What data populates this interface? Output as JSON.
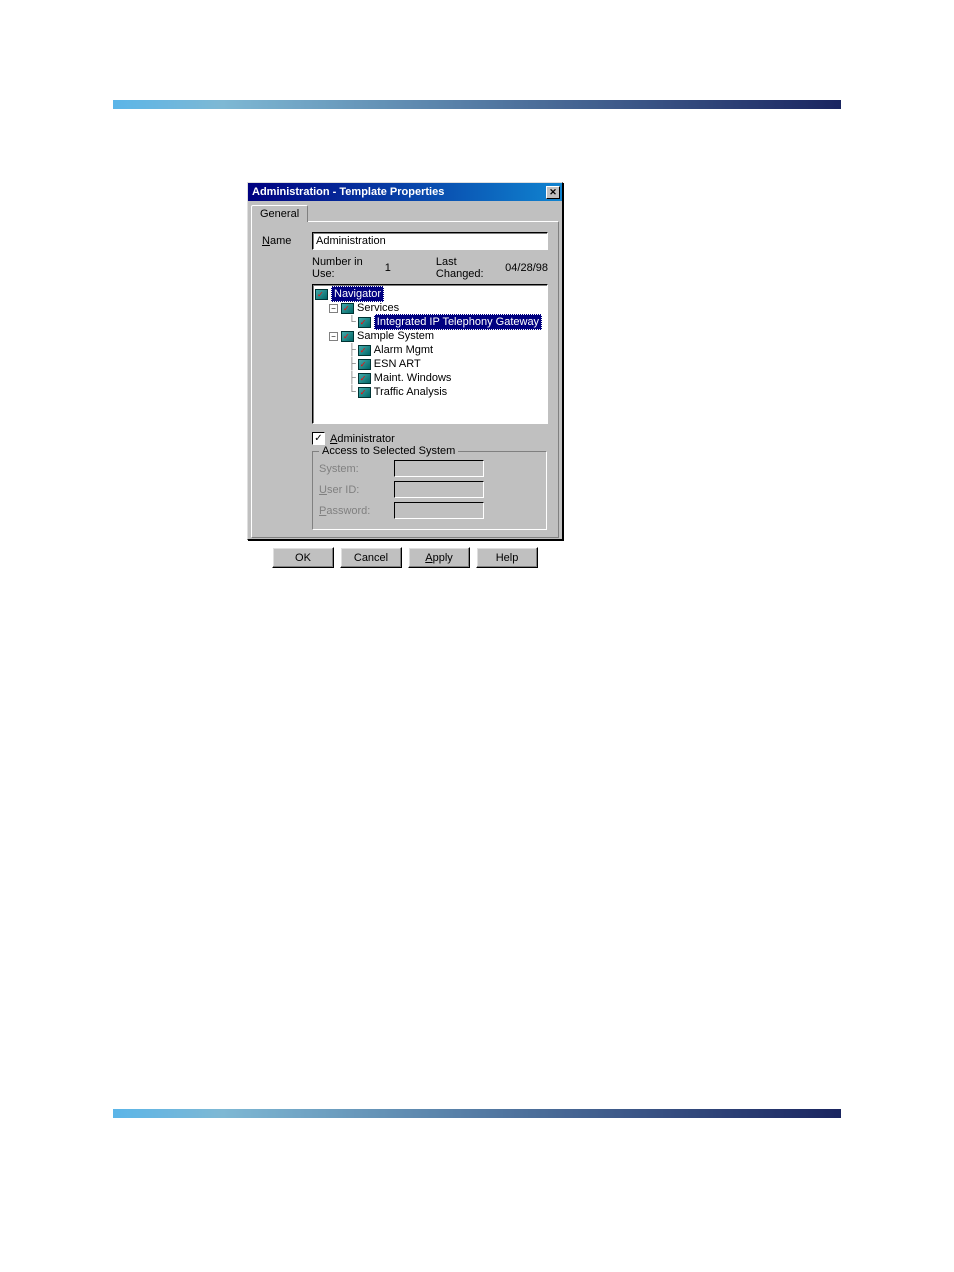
{
  "dialog": {
    "title": "Administration - Template Properties",
    "tab": "General",
    "name_label": "Name",
    "name_underline": "N",
    "name_value": "Administration",
    "number_in_use_label": "Number in Use:",
    "number_in_use_value": "1",
    "last_changed_label": "Last Changed:",
    "last_changed_value": "04/28/98",
    "tree": {
      "root": "Navigator",
      "services": "Services",
      "itg": "Integrated IP Telephony Gateway",
      "sample_system": "Sample System",
      "alarm_mgmt": "Alarm Mgmt",
      "esn_art": "ESN ART",
      "maint_windows": "Maint. Windows",
      "traffic_analysis": "Traffic Analysis"
    },
    "administrator_label": "Administrator",
    "administrator_underline": "A",
    "groupbox_title": "Access to Selected System",
    "system_label": "System:",
    "userid_label": "User ID:",
    "userid_underline": "U",
    "password_label": "Password:",
    "password_underline": "P",
    "buttons": {
      "ok": "OK",
      "cancel": "Cancel",
      "apply": "Apply",
      "apply_underline": "A",
      "help": "Help"
    }
  }
}
